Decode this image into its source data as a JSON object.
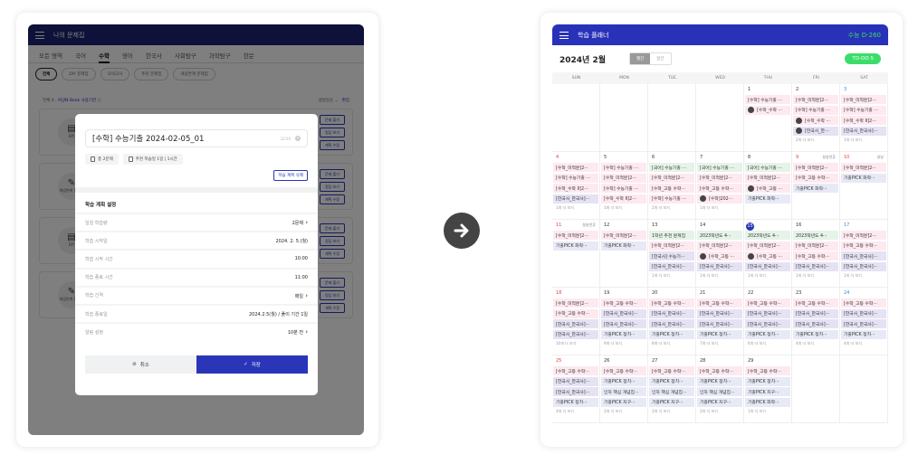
{
  "left": {
    "header": {
      "title": "나의 문제집",
      "color": "#1c2272"
    },
    "tabs": [
      "모든 영역",
      "국어",
      "수학",
      "영어",
      "한국사",
      "사회탐구",
      "과학탐구",
      "한문"
    ],
    "active_tab": "수학",
    "chips": [
      "전체",
      "DIY 문제집",
      "모의고사",
      "추천 문제집",
      "개념연계 문제집"
    ],
    "info": {
      "count": "전체 4",
      "link": "비상N Book 사용기한 ⓘ",
      "sort": "생성일순 ⌄",
      "edit": "편집"
    },
    "cards": [
      {
        "type": "DIY",
        "icon": "diy-book-icon"
      },
      {
        "type": "개념연계 문제집",
        "icon": "concept-book-icon"
      },
      {
        "type": "DIY",
        "icon": "diy-book-icon"
      },
      {
        "type": "개념연계 문제집",
        "icon": "concept-book-icon"
      }
    ],
    "card_buttons": [
      "문제 풀기",
      "정답 보기",
      "계획 수정"
    ],
    "modal": {
      "title_value": "[수학] 수능기출 2024-02-05_01",
      "char_count": "22/30",
      "total": "총 2문제",
      "recommend": "추천 학습일 1일 | 1시간",
      "delete_label": "학습 계획 삭제",
      "section_title": "학습 계획 설정",
      "rows": [
        {
          "label": "일일 학습량",
          "value": "2문제",
          "chevron": true
        },
        {
          "label": "학습 시작일",
          "value": "2024. 2. 5.(월)",
          "chevron": false
        },
        {
          "label": "학습 시작 시간",
          "value": "10:00",
          "chevron": false
        },
        {
          "label": "학습 종료 시간",
          "value": "11:00",
          "chevron": false
        },
        {
          "label": "학습 간격",
          "value": "매일",
          "chevron": true
        },
        {
          "label": "학습 종료일",
          "value": "2024.2.5(월) / 풀이 기간 1일",
          "chevron": false
        },
        {
          "label": "알림 설정",
          "value": "10분 전",
          "chevron": true
        }
      ],
      "cancel": "취소",
      "save": "저장",
      "save_color": "#2a35b8"
    }
  },
  "right": {
    "header": {
      "title": "학습 플래너",
      "dday": "수능 D-260",
      "color": "#2832b8",
      "dday_color": "#3bdd6a"
    },
    "month": "2024년 2월",
    "view_toggle": [
      "월간",
      "일간"
    ],
    "active_view": "월간",
    "todo": "TO-DO 5",
    "weekdays": [
      "SUN",
      "MON",
      "TUE",
      "WED",
      "THU",
      "FRI",
      "SAT"
    ],
    "today": 15,
    "event_colors": {
      "p": "#fde9ef",
      "g": "#e5f3e8",
      "v": "#e4e2f3",
      "b": "#e7e9f6"
    },
    "weeks": [
      [
        null,
        null,
        null,
        null,
        {
          "d": 1,
          "ev": [
            {
              "t": "[수학] 수능기출 ···",
              "c": "p"
            },
            {
              "t": "[수학_수학 ···",
              "c": "p",
              "badge": true
            }
          ]
        },
        {
          "d": 2,
          "ev": [
            {
              "t": "[수학_미적분]2···",
              "c": "p"
            },
            {
              "t": "[수학] 수능기출 ···",
              "c": "p"
            },
            {
              "t": "[수학_수학 ···",
              "c": "p",
              "badge": true
            },
            {
              "t": "[한국사_한···",
              "c": "v",
              "badge": true
            }
          ],
          "more": "2개 더 보기."
        },
        {
          "d": 3,
          "ev": [
            {
              "t": "[수학_미적분]2···",
              "c": "p"
            },
            {
              "t": "[수학] 수능기출 ···",
              "c": "p"
            },
            {
              "t": "[수학_수학 II]2···",
              "c": "p"
            },
            {
              "t": "[한국사_한국사]···",
              "c": "v"
            }
          ],
          "more": "1개 더 보기."
        }
      ],
      [
        {
          "d": 4,
          "ev": [
            {
              "t": "[수학_미적분]2···",
              "c": "p"
            },
            {
              "t": "[수학] 수능기출 ···",
              "c": "p"
            },
            {
              "t": "[수학_수학 II]2···",
              "c": "p"
            },
            {
              "t": "[한국사_한국사]···",
              "c": "v"
            }
          ],
          "more": "1개 더 보기."
        },
        {
          "d": 5,
          "ev": [
            {
              "t": "[수학] 수능기출 ···",
              "c": "p"
            },
            {
              "t": "[수학_미적분]2···",
              "c": "p"
            },
            {
              "t": "[수학] 수능기출 ···",
              "c": "p"
            },
            {
              "t": "[수학_수학 II]2···",
              "c": "p"
            }
          ],
          "more": "3개 더 보기."
        },
        {
          "d": 6,
          "ev": [
            {
              "t": "[국어] 수능기출 ···",
              "c": "g"
            },
            {
              "t": "[수학_미적분]2···",
              "c": "p"
            },
            {
              "t": "[수학_고등 수학···",
              "c": "p"
            },
            {
              "t": "[수학] 수능기출 ···",
              "c": "p"
            }
          ],
          "more": "2개 더 보기."
        },
        {
          "d": 7,
          "ev": [
            {
              "t": "[국어] 수능기출 ···",
              "c": "g"
            },
            {
              "t": "[수학_미적분]2···",
              "c": "p"
            },
            {
              "t": "[수학_고등 수학···",
              "c": "p"
            },
            {
              "t": "[수학]202···",
              "c": "p",
              "badge": true
            }
          ],
          "more": "1개 더 보기."
        },
        {
          "d": 8,
          "ev": [
            {
              "t": "[국어] 수능기출 ···",
              "c": "g"
            },
            {
              "t": "[수학_미적분]2···",
              "c": "p"
            },
            {
              "t": "[수학_고등 ···",
              "c": "p",
              "badge": true
            },
            {
              "t": "기출PICK 화학···",
              "c": "b"
            }
          ]
        },
        {
          "d": 9,
          "hol": "설날연휴",
          "ev": [
            {
              "t": "[수학_미적분]2···",
              "c": "p"
            },
            {
              "t": "[수학_고등 수학···",
              "c": "p"
            },
            {
              "t": "기출PICK 화학···",
              "c": "b"
            }
          ]
        },
        {
          "d": 10,
          "hol": "설날",
          "ev": [
            {
              "t": "[수학_미적분]2···",
              "c": "p"
            },
            {
              "t": "기출PICK 화학···",
              "c": "b"
            }
          ]
        }
      ],
      [
        {
          "d": 11,
          "hol": "설날연휴",
          "ev": [
            {
              "t": "[수학_미적분]2···",
              "c": "p"
            },
            {
              "t": "기출PICK 화학···",
              "c": "b"
            }
          ]
        },
        {
          "d": 12,
          "ev": [
            {
              "t": "[수학_미적분]2···",
              "c": "p"
            },
            {
              "t": "기출PICK 화학···",
              "c": "b"
            }
          ]
        },
        {
          "d": 13,
          "ev": [
            {
              "t": "1학년 추천 문제집",
              "c": "g"
            },
            {
              "t": "[수학_미적분]2···",
              "c": "p"
            },
            {
              "t": "[한국사] 수능기···",
              "c": "v"
            },
            {
              "t": "[한국사_한국사]···",
              "c": "v"
            }
          ],
          "more": "1개 더 보기."
        },
        {
          "d": 14,
          "ev": [
            {
              "t": "2023학년도 4···",
              "c": "g"
            },
            {
              "t": "[수학_미적분]2···",
              "c": "p"
            },
            {
              "t": "[수학_고등 ···",
              "c": "p",
              "badge": true
            },
            {
              "t": "[한국사_한국사]···",
              "c": "v"
            }
          ],
          "more": "1개 더 보기."
        },
        {
          "d": 15,
          "ev": [
            {
              "t": "2023학년도 4···",
              "c": "g"
            },
            {
              "t": "[수학_미적분]2···",
              "c": "p"
            },
            {
              "t": "[수학_고등 ···",
              "c": "p",
              "badge": true
            },
            {
              "t": "[한국사_한국사]···",
              "c": "v"
            }
          ],
          "more": "1개 더 보기."
        },
        {
          "d": 16,
          "ev": [
            {
              "t": "2023학년도 4···",
              "c": "g"
            },
            {
              "t": "[수학_미적분]2···",
              "c": "p"
            },
            {
              "t": "[수학_고등 수학···",
              "c": "p"
            },
            {
              "t": "[한국사_한국사]···",
              "c": "v"
            }
          ],
          "more": "1개 더 보기."
        },
        {
          "d": 17,
          "ev": [
            {
              "t": "[수학_미적분]2···",
              "c": "p"
            },
            {
              "t": "[수학_고등 수학···",
              "c": "p"
            },
            {
              "t": "[한국사_한국사]···",
              "c": "v"
            },
            {
              "t": "[한국사_한국사]···",
              "c": "v"
            }
          ],
          "more": "1개 더 보기."
        }
      ],
      [
        {
          "d": 18,
          "ev": [
            {
              "t": "[수학_미적분]2···",
              "c": "p"
            },
            {
              "t": "[수학_고등 수학···",
              "c": "p"
            },
            {
              "t": "[한국사_한국사]···",
              "c": "v"
            },
            {
              "t": "[한국사_한국사]···",
              "c": "v"
            }
          ],
          "more": "10개 더 보기."
        },
        {
          "d": 19,
          "ev": [
            {
              "t": "[수학_고등 수학···",
              "c": "p"
            },
            {
              "t": "[한국사_한국사]···",
              "c": "v"
            },
            {
              "t": "[한국사_한국사]···",
              "c": "v"
            },
            {
              "t": "기출PICK 정치···",
              "c": "b"
            }
          ],
          "more": "9개 더 보기."
        },
        {
          "d": 20,
          "ev": [
            {
              "t": "[수학_고등 수학···",
              "c": "p"
            },
            {
              "t": "[한국사_한국사]···",
              "c": "v"
            },
            {
              "t": "[한국사_한국사]···",
              "c": "v"
            },
            {
              "t": "기출PICK 정치···",
              "c": "b"
            }
          ],
          "more": "8개 더 보기."
        },
        {
          "d": 21,
          "ev": [
            {
              "t": "[수학_고등 수학···",
              "c": "p"
            },
            {
              "t": "[한국사_한국사]···",
              "c": "v"
            },
            {
              "t": "[한국사_한국사]···",
              "c": "v"
            },
            {
              "t": "기출PICK 정치···",
              "c": "b"
            }
          ],
          "more": "7개 더 보기."
        },
        {
          "d": 22,
          "ev": [
            {
              "t": "[수학_고등 수학···",
              "c": "p"
            },
            {
              "t": "[한국사_한국사]···",
              "c": "v"
            },
            {
              "t": "[한국사_한국사]···",
              "c": "v"
            },
            {
              "t": "기출PICK 정치···",
              "c": "b"
            }
          ],
          "more": "6개 더 보기."
        },
        {
          "d": 23,
          "ev": [
            {
              "t": "[수학_고등 수학···",
              "c": "p"
            },
            {
              "t": "[한국사_한국사]···",
              "c": "v"
            },
            {
              "t": "[한국사_한국사]···",
              "c": "v"
            },
            {
              "t": "기출PICK 정치···",
              "c": "b"
            }
          ],
          "more": "4개 더 보기."
        },
        {
          "d": 24,
          "ev": [
            {
              "t": "[수학_고등 수학···",
              "c": "p"
            },
            {
              "t": "[한국사_한국사]···",
              "c": "v"
            },
            {
              "t": "[한국사_한국사]···",
              "c": "v"
            },
            {
              "t": "기출PICK 정치···",
              "c": "b"
            }
          ],
          "more": "4개 더 보기."
        }
      ],
      [
        {
          "d": 25,
          "ev": [
            {
              "t": "[수학_고등 수학···",
              "c": "p"
            },
            {
              "t": "[한국사_한국사]···",
              "c": "v"
            },
            {
              "t": "[한국사_한국사]···",
              "c": "v"
            },
            {
              "t": "기출PICK 정치···",
              "c": "b"
            }
          ],
          "more": "4개 더 보기."
        },
        {
          "d": 26,
          "ev": [
            {
              "t": "[수학_고등 수학···",
              "c": "p"
            },
            {
              "t": "기출PICK 정치···",
              "c": "b"
            },
            {
              "t": "인자 핵심 개념집···",
              "c": "b"
            },
            {
              "t": "기출PICK 지구···",
              "c": "b"
            }
          ],
          "more": "2개 더 보기."
        },
        {
          "d": 27,
          "ev": [
            {
              "t": "[수학_고등 수학···",
              "c": "p"
            },
            {
              "t": "기출PICK 정치···",
              "c": "b"
            },
            {
              "t": "인자 핵심 개념집···",
              "c": "b"
            },
            {
              "t": "기출PICK 지구···",
              "c": "b"
            }
          ],
          "more": "2개 더 보기."
        },
        {
          "d": 28,
          "ev": [
            {
              "t": "[수학_고등 수학···",
              "c": "p"
            },
            {
              "t": "기출PICK 정치···",
              "c": "b"
            },
            {
              "t": "인자 핵심 개념집···",
              "c": "b"
            },
            {
              "t": "기출PICK 지구···",
              "c": "b"
            }
          ],
          "more": "2개 더 보기."
        },
        {
          "d": 29,
          "ev": [
            {
              "t": "[수학_고등 수학···",
              "c": "p"
            },
            {
              "t": "기출PICK 정치···",
              "c": "b"
            },
            {
              "t": "기출PICK 지구···",
              "c": "b"
            },
            {
              "t": "기출PICK 화학···",
              "c": "b"
            }
          ],
          "more": "1개 더 보기."
        },
        null,
        null
      ]
    ]
  }
}
